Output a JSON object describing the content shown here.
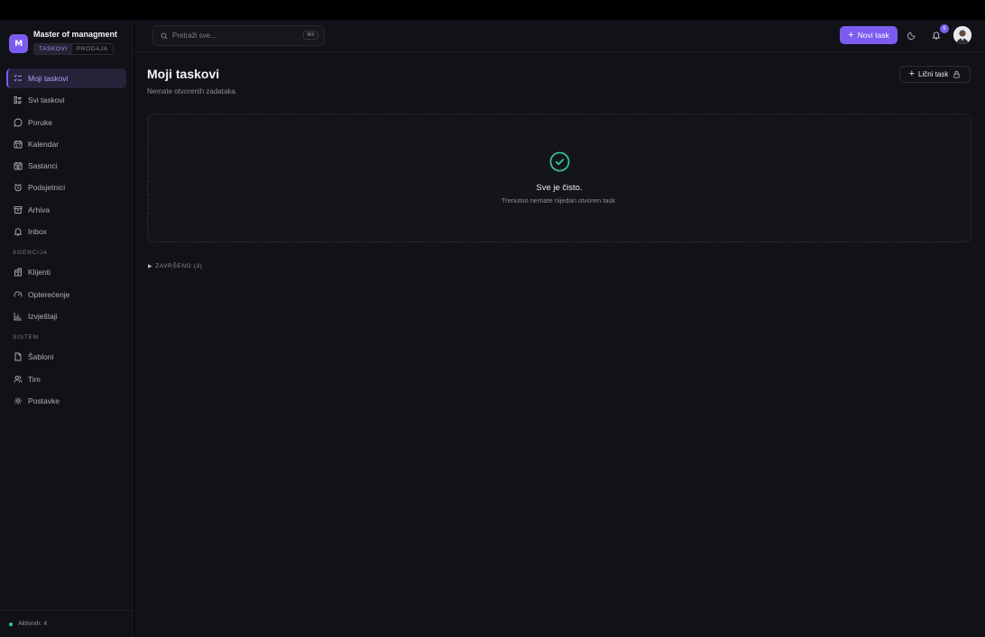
{
  "brand": {
    "logo_text": "M",
    "title": "Master of managment",
    "tabs": [
      {
        "label": "TASKOVI",
        "active": true
      },
      {
        "label": "PRODAJA",
        "active": false
      }
    ]
  },
  "nav": {
    "main": [
      {
        "label": "Moji taskovi",
        "icon": "list-check-icon",
        "active": true
      },
      {
        "label": "Svi taskovi",
        "icon": "list-icon"
      },
      {
        "label": "Poruke",
        "icon": "message-icon"
      },
      {
        "label": "Kalendar",
        "icon": "calendar-icon"
      },
      {
        "label": "Sastanci",
        "icon": "meeting-calendar-icon"
      },
      {
        "label": "Podsjetnici",
        "icon": "alarm-clock-icon"
      },
      {
        "label": "Arhiva",
        "icon": "archive-icon"
      },
      {
        "label": "Inbox",
        "icon": "bell-icon"
      }
    ],
    "agencija_label": "AGENCIJA",
    "agencija": [
      {
        "label": "Klijenti",
        "icon": "building-icon"
      },
      {
        "label": "Opterećenje",
        "icon": "gauge-icon"
      },
      {
        "label": "Izvještaji",
        "icon": "bar-chart-icon"
      }
    ],
    "sistem_label": "SISTEM",
    "sistem": [
      {
        "label": "Šabloni",
        "icon": "file-icon"
      },
      {
        "label": "Tim",
        "icon": "users-icon"
      },
      {
        "label": "Postavke",
        "icon": "gear-icon"
      }
    ]
  },
  "footer": {
    "active_label": "Aktivnih: 4",
    "status_color": "#36c98a"
  },
  "header": {
    "search_placeholder": "Pretraži sve...",
    "search_shortcut": "⌘K",
    "new_task_label": "Novi task",
    "notification_count": "6"
  },
  "main": {
    "title": "Moji taskovi",
    "subtitle": "Nemate otvorenih zadataka.",
    "personal_task_label": "Lični task",
    "empty_title": "Sve je čisto.",
    "empty_subtitle": "Trenutno nemate nijedan otvoren task.",
    "completed_label": "ZAVRŠENO (3)"
  },
  "colors": {
    "accent": "#7c5cf0",
    "success": "#36c98a",
    "background": "#111217"
  }
}
